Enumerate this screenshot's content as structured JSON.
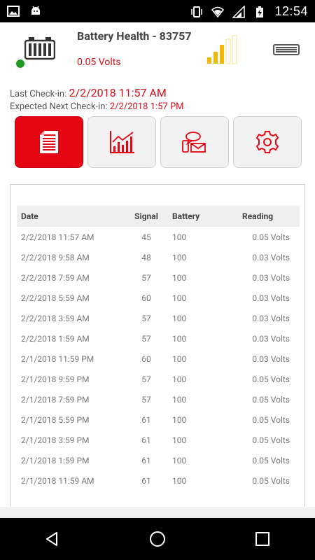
{
  "status_bar": {
    "time": "12:54",
    "icons": [
      "image-icon",
      "android-icon",
      "vibrate-icon",
      "wifi-icon",
      "signal-icon",
      "battery-charging-icon"
    ]
  },
  "header": {
    "title": "Battery Health - 83757",
    "subtitle": "0.05 Volts",
    "status": "online",
    "status_color": "#1f9a22",
    "signal_bars_active": 3,
    "accent": "#d50f1a"
  },
  "checkin": {
    "last_label": "Last Check-in: ",
    "last_value": "2/2/2018 11:57 AM",
    "next_label": "Expected Next Check-in: ",
    "next_value": "2/2/2018 1:57 PM"
  },
  "tabs": [
    {
      "name": "readings",
      "icon": "document-icon",
      "active": true
    },
    {
      "name": "chart",
      "icon": "chart-icon",
      "active": false
    },
    {
      "name": "alerts",
      "icon": "message-icon",
      "active": false
    },
    {
      "name": "settings",
      "icon": "gear-icon",
      "active": false
    }
  ],
  "table": {
    "headers": {
      "date": "Date",
      "signal": "Signal",
      "battery": "Battery",
      "reading": "Reading"
    },
    "rows": [
      {
        "date": "2/2/2018 11:57 AM",
        "signal": "45",
        "battery": "100",
        "reading": "0.05 Volts"
      },
      {
        "date": "2/2/2018 9:58 AM",
        "signal": "48",
        "battery": "100",
        "reading": "0.03 Volts"
      },
      {
        "date": "2/2/2018 7:59 AM",
        "signal": "57",
        "battery": "100",
        "reading": "0.03 Volts"
      },
      {
        "date": "2/2/2018 5:59 AM",
        "signal": "60",
        "battery": "100",
        "reading": "0.03 Volts"
      },
      {
        "date": "2/2/2018 3:59 AM",
        "signal": "57",
        "battery": "100",
        "reading": "0.03 Volts"
      },
      {
        "date": "2/2/2018 1:59 AM",
        "signal": "57",
        "battery": "100",
        "reading": "0.03 Volts"
      },
      {
        "date": "2/1/2018 11:59 PM",
        "signal": "60",
        "battery": "100",
        "reading": "0.03 Volts"
      },
      {
        "date": "2/1/2018 9:59 PM",
        "signal": "57",
        "battery": "100",
        "reading": "0.05 Volts"
      },
      {
        "date": "2/1/2018 7:59 PM",
        "signal": "57",
        "battery": "100",
        "reading": "0.05 Volts"
      },
      {
        "date": "2/1/2018 5:59 PM",
        "signal": "61",
        "battery": "100",
        "reading": "0.05 Volts"
      },
      {
        "date": "2/1/2018 3:59 PM",
        "signal": "61",
        "battery": "100",
        "reading": "0.05 Volts"
      },
      {
        "date": "2/1/2018 1:59 PM",
        "signal": "61",
        "battery": "100",
        "reading": "0.05 Volts"
      },
      {
        "date": "2/1/2018 11:59 AM",
        "signal": "61",
        "battery": "100",
        "reading": "0.05 Volts"
      }
    ]
  },
  "nav": {
    "buttons": [
      "back-icon",
      "home-icon",
      "recents-icon"
    ]
  }
}
